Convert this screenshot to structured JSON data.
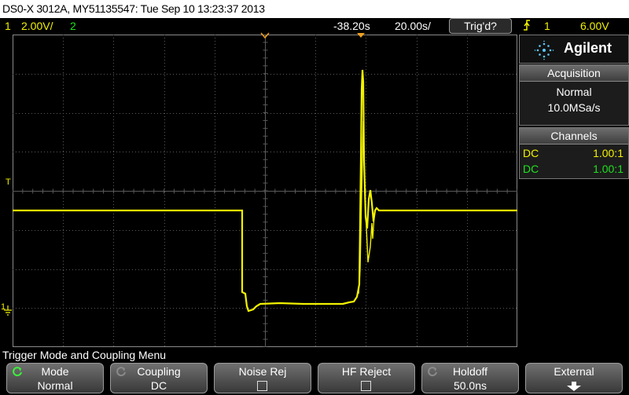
{
  "title_bar": {
    "text": "DS0-X 3012A, MY51135547: Tue Sep 10 13:23:37 2013"
  },
  "status_bar": {
    "ch1_label": "1",
    "ch1_scale": "2.00V/",
    "ch2_label": "2",
    "time_offset": "-38.20s",
    "time_scale": "20.00s/",
    "trigger_status": "Trig'd?",
    "trigger_source": "1",
    "trigger_level": "6.00V"
  },
  "side_panel": {
    "brand": "Agilent",
    "acquisition": {
      "header": "Acquisition",
      "mode": "Normal",
      "rate": "10.0MSa/s"
    },
    "channels": {
      "header": "Channels",
      "rows": [
        {
          "coupling": "DC",
          "ratio": "1.00:1",
          "color": "#f2f200"
        },
        {
          "coupling": "DC",
          "ratio": "1.00:1",
          "color": "#20e020"
        }
      ]
    }
  },
  "display": {
    "trigger_marker": "T",
    "ch1_ground_marker": "1",
    "trace_color": "#f2f200",
    "grid_color": "#5a5a5a"
  },
  "menu": {
    "title": "Trigger Mode and Coupling Menu",
    "softkeys": [
      {
        "line1": "Mode",
        "line2": "Normal",
        "icon": "rotate-icon"
      },
      {
        "line1": "Coupling",
        "line2": "DC",
        "icon": "rotate-icon"
      },
      {
        "line1": "Noise Rej",
        "line2": "",
        "icon": "checkbox"
      },
      {
        "line1": "HF Reject",
        "line2": "",
        "icon": "checkbox"
      },
      {
        "line1": "Holdoff",
        "line2": "50.0ns",
        "icon": "rotate-icon"
      },
      {
        "line1": "External",
        "line2": "",
        "icon": "down-arrow-icon"
      }
    ]
  }
}
